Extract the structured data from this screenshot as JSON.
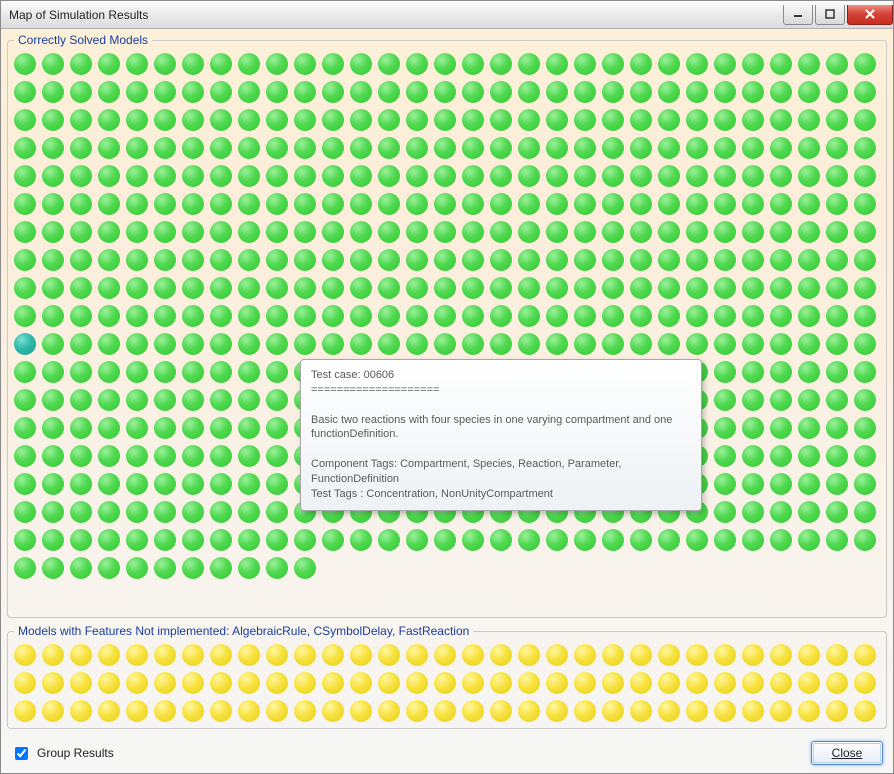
{
  "window": {
    "title": "Map of Simulation Results"
  },
  "groups": {
    "correct": {
      "legend": "Correctly Solved Models"
    },
    "notimpl": {
      "legend": "Models with Features Not implemented: AlgebraicRule, CSymbolDelay, FastReaction"
    }
  },
  "grid": {
    "correct_total": 569,
    "correct_teal_index": 310,
    "yellow_total": 93
  },
  "tooltip": {
    "text": "Test case: 00606\n====================\n\nBasic two reactions with four species in one varying compartment and one functionDefinition.\n\nComponent Tags: Compartment, Species, Reaction, Parameter, FunctionDefinition\nTest Tags          : Concentration, NonUnityCompartment"
  },
  "footer": {
    "group_results_label": "Group Results",
    "group_results_checked": true,
    "close_label": "Close"
  }
}
